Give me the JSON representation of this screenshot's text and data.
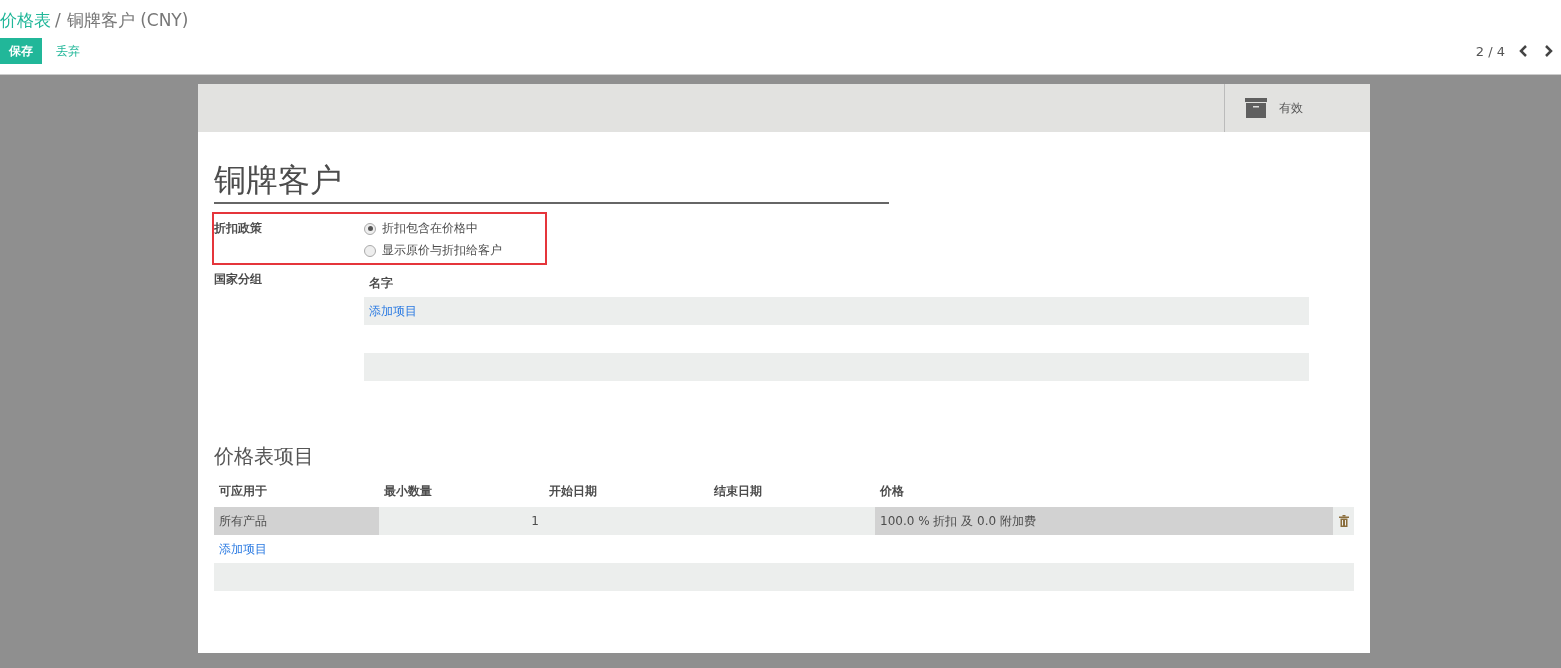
{
  "breadcrumb": [
    {
      "label": "价格表",
      "kind": "link",
      "separator": "/"
    },
    {
      "label": "铜牌客户 (CNY)",
      "kind": "current"
    }
  ],
  "buttons": [
    {
      "label": "保存",
      "kind": "primary"
    },
    {
      "label": "丢弃",
      "kind": "link"
    }
  ],
  "pager": {
    "text": "2 / 4"
  },
  "status_button": {
    "label": "有效"
  },
  "record_name": "铜牌客户",
  "discount_policy": {
    "label": "折扣政策",
    "highlighted": true,
    "options": [
      {
        "label": "折扣包含在价格中",
        "selected": true
      },
      {
        "label": "显示原价与折扣给客户",
        "selected": false
      }
    ]
  },
  "country_groups": {
    "label": "国家分组",
    "columns": [
      "名字"
    ],
    "add_item": "添加项目"
  },
  "items_section": {
    "title": "价格表项目",
    "columns": [
      "可应用于",
      "最小数量",
      "开始日期",
      "结束日期",
      "价格"
    ],
    "rows": [
      {
        "cells": [
          {
            "text": "所有产品",
            "kind": "text",
            "highlighted": true
          },
          {
            "text": "1",
            "kind": "number",
            "highlighted": false
          },
          {
            "text": "",
            "kind": "text",
            "highlighted": false
          },
          {
            "text": "",
            "kind": "text",
            "highlighted": false
          },
          {
            "text": "100.0 % 折扣 及 0.0 附加费",
            "kind": "text",
            "highlighted": true
          }
        ]
      }
    ],
    "add_item": "添加项目"
  }
}
